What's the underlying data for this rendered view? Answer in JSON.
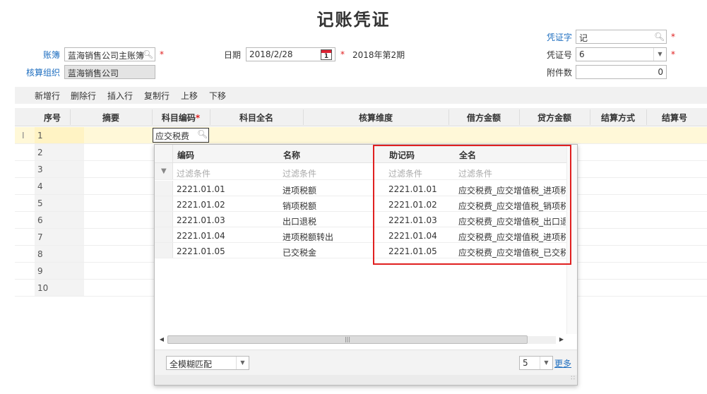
{
  "title": "记账凭证",
  "form": {
    "ledger_label": "账簿",
    "ledger_value": "蓝海销售公司主账簿",
    "org_label": "核算组织",
    "org_value": "蓝海销售公司",
    "date_label": "日期",
    "date_value": "2018/2/28",
    "calendar_day": "1",
    "period_text": "2018年第2期",
    "voucher_word_label": "凭证字",
    "voucher_word_value": "记",
    "voucher_no_label": "凭证号",
    "voucher_no_value": "6",
    "attachments_label": "附件数",
    "attachments_value": "0",
    "required_mark": "*"
  },
  "toolbar": {
    "add_row": "新增行",
    "delete_row": "删除行",
    "insert_row": "插入行",
    "copy_row": "复制行",
    "move_up": "上移",
    "move_down": "下移"
  },
  "grid": {
    "columns": [
      "序号",
      "摘要",
      "科目编码",
      "科目全名",
      "核算维度",
      "借方金额",
      "贷方金额",
      "结算方式",
      "结算号"
    ],
    "rows": [
      "1",
      "2",
      "3",
      "4",
      "5",
      "6",
      "7",
      "8",
      "9",
      "10"
    ],
    "current_cell_value": "应交税费",
    "row_marker": "I"
  },
  "popup": {
    "columns": [
      "编码",
      "名称",
      "助记码",
      "全名"
    ],
    "filter_placeholder": "过滤条件",
    "rows": [
      {
        "code": "2221.01.01",
        "name": "进项税额",
        "mnemonic": "2221.01.01",
        "fullname": "应交税费_应交增值税_进项税额"
      },
      {
        "code": "2221.01.02",
        "name": "销项税额",
        "mnemonic": "2221.01.02",
        "fullname": "应交税费_应交增值税_销项税额"
      },
      {
        "code": "2221.01.03",
        "name": "出口退税",
        "mnemonic": "2221.01.03",
        "fullname": "应交税费_应交增值税_出口退税"
      },
      {
        "code": "2221.01.04",
        "name": "进项税额转出",
        "mnemonic": "2221.01.04",
        "fullname": "应交税费_应交增值税_进项税额转出"
      },
      {
        "code": "2221.01.05",
        "name": "已交税金",
        "mnemonic": "2221.01.05",
        "fullname": "应交税费_应交增值税_已交税金"
      }
    ],
    "match_mode": "全模糊匹配",
    "page_size": "5",
    "more_link": "更多"
  },
  "colors": {
    "accent_blue": "#1f6fc0",
    "required_red": "#e02020",
    "highlight_row": "#fff8d8"
  }
}
